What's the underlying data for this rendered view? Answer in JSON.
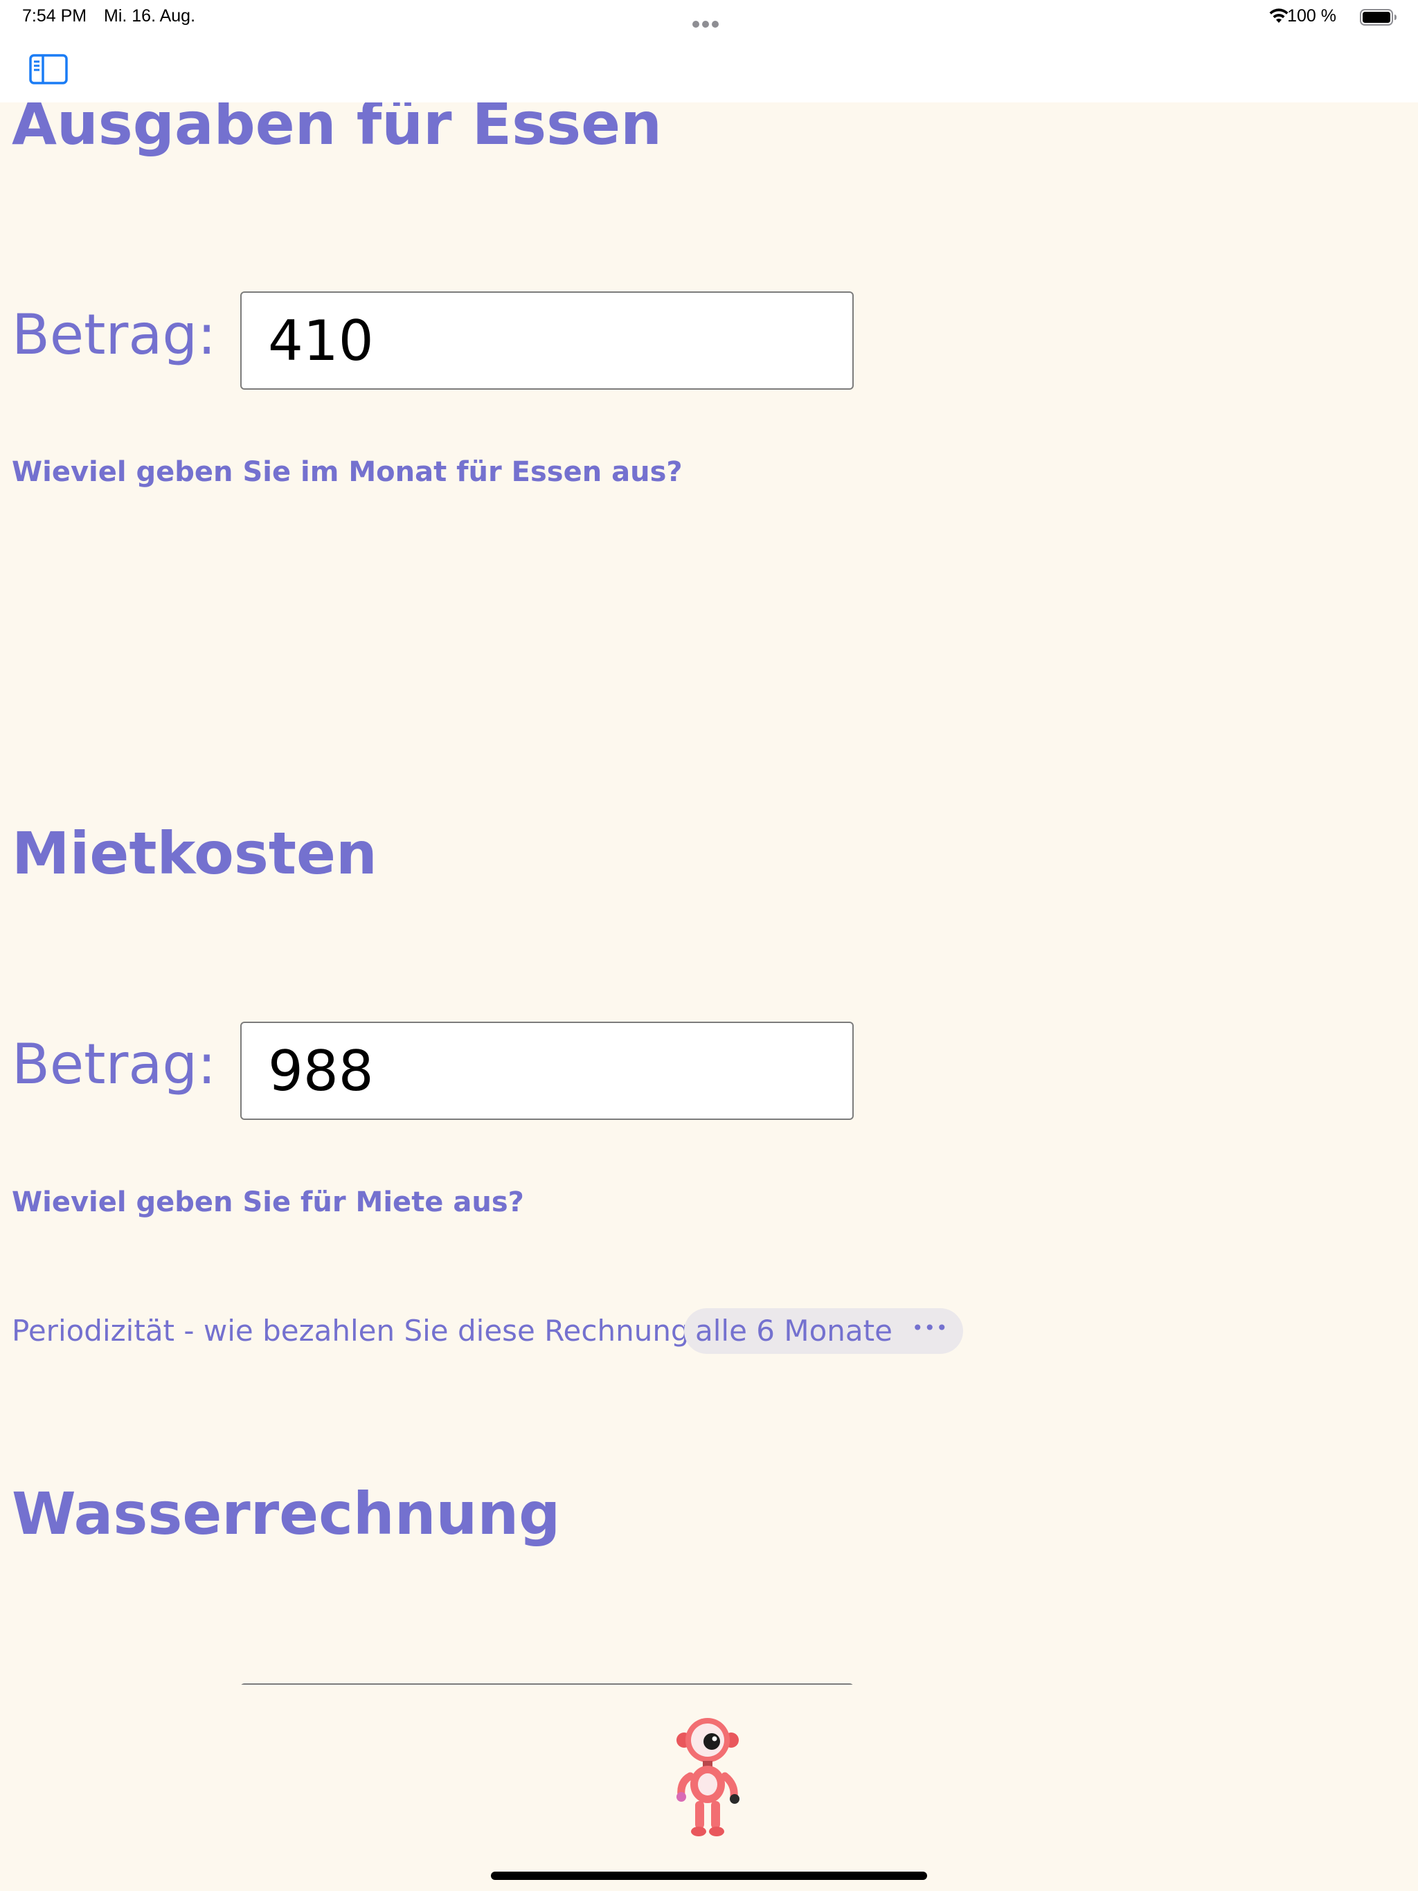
{
  "status_bar": {
    "time": "7:54 PM",
    "date": "Mi. 16. Aug.",
    "battery_percent": "100 %"
  },
  "nav": {
    "sidebar_toggle_icon": "sidebar-left-icon"
  },
  "sections": {
    "food": {
      "title": "Ausgaben für Essen",
      "amount_label": "Betrag:",
      "amount_value": "410",
      "question": "Wieviel geben Sie im Monat für Essen aus?"
    },
    "rent": {
      "title": "Mietkosten",
      "amount_label": "Betrag:",
      "amount_value": "988",
      "question": "Wieviel geben Sie für Miete aus?",
      "period_label": "Periodizität - wie bezahlen Sie diese Rechnung:",
      "period_value": "alle 6 Monate",
      "period_menu_icon": "ellipsis-icon"
    },
    "water": {
      "title": "Wasserrechnung"
    }
  },
  "footer": {
    "mascot_icon": "robot-mascot-icon"
  },
  "colors": {
    "accent": "#7471cf",
    "background": "#fdf8ee",
    "select_background": "#ebe8eb",
    "system_blue": "#1a7cf5"
  }
}
